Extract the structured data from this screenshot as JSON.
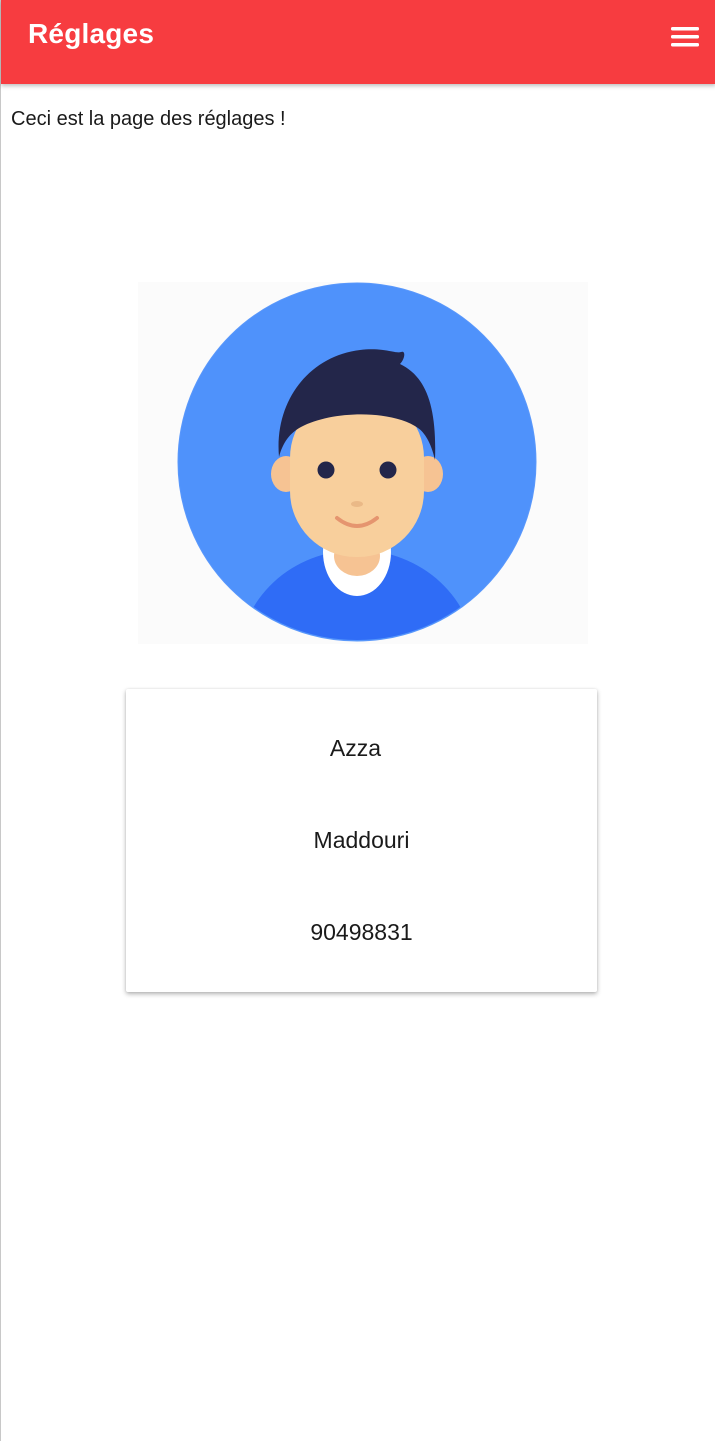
{
  "app_bar": {
    "title": "Réglages",
    "menu_icon": "menu-icon",
    "background_color": "#f73c40"
  },
  "content": {
    "intro_text": "Ceci est la page des réglages !"
  },
  "avatar": {
    "icon": "user-avatar-illustration",
    "circle_color": "#4f92fb",
    "shirt_color": "#2f6cf6",
    "hair_color": "#23264a",
    "skin_color": "#f8cf9c"
  },
  "profile_card": {
    "first_name": "Azza",
    "last_name": "Maddouri",
    "phone": "90498831"
  }
}
